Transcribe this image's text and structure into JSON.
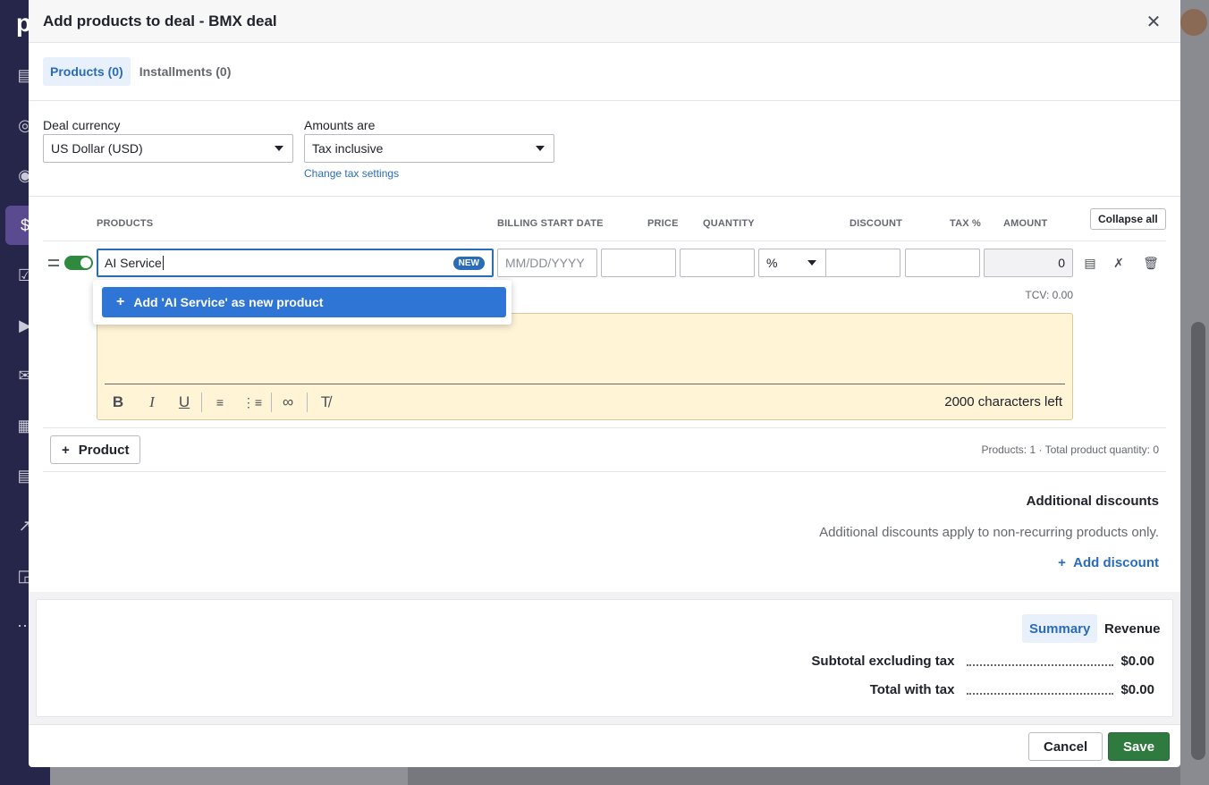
{
  "modal": {
    "title": "Add products to deal - BMX deal",
    "tabs": [
      {
        "label": "Products (0)",
        "active": true
      },
      {
        "label": "Installments (0)",
        "active": false
      }
    ]
  },
  "settings": {
    "currency_label": "Deal currency",
    "currency_value": "US Dollar (USD)",
    "amounts_label": "Amounts are",
    "amounts_value": "Tax inclusive",
    "tax_link": "Change tax settings"
  },
  "columns": {
    "products": "PRODUCTS",
    "billing_start": "BILLING START DATE",
    "price": "PRICE",
    "quantity": "QUANTITY",
    "discount": "DISCOUNT",
    "tax": "TAX %",
    "amount": "AMOUNT",
    "collapse_all": "Collapse all"
  },
  "row": {
    "product_value": "AI Service",
    "new_badge": "NEW",
    "date_placeholder": "MM/DD/YYYY",
    "discount_type": "%",
    "amount": "0",
    "tcv": "TCV: 0.00",
    "chars_left": "2000 characters left"
  },
  "dropdown": {
    "option": "Add 'AI Service' as new product"
  },
  "product_bar": {
    "add_label": "Product",
    "summary": "Products: 1  ·  Total product quantity: 0"
  },
  "discounts": {
    "title": "Additional discounts",
    "note": "Additional discounts apply to non-recurring products only.",
    "add_label": "Add discount"
  },
  "summary": {
    "tabs": [
      {
        "label": "Summary",
        "active": true
      },
      {
        "label": "Revenue",
        "active": false
      }
    ],
    "subtotal_label": "Subtotal excluding tax",
    "subtotal_value": "$0.00",
    "total_label": "Total with tax",
    "total_value": "$0.00"
  },
  "actions": {
    "cancel": "Cancel",
    "save": "Save"
  },
  "colors": {
    "accent": "#2b6cb8",
    "save": "#2f7a3e",
    "note_bg": "#fff4d6",
    "sidebar": "#26264a"
  }
}
